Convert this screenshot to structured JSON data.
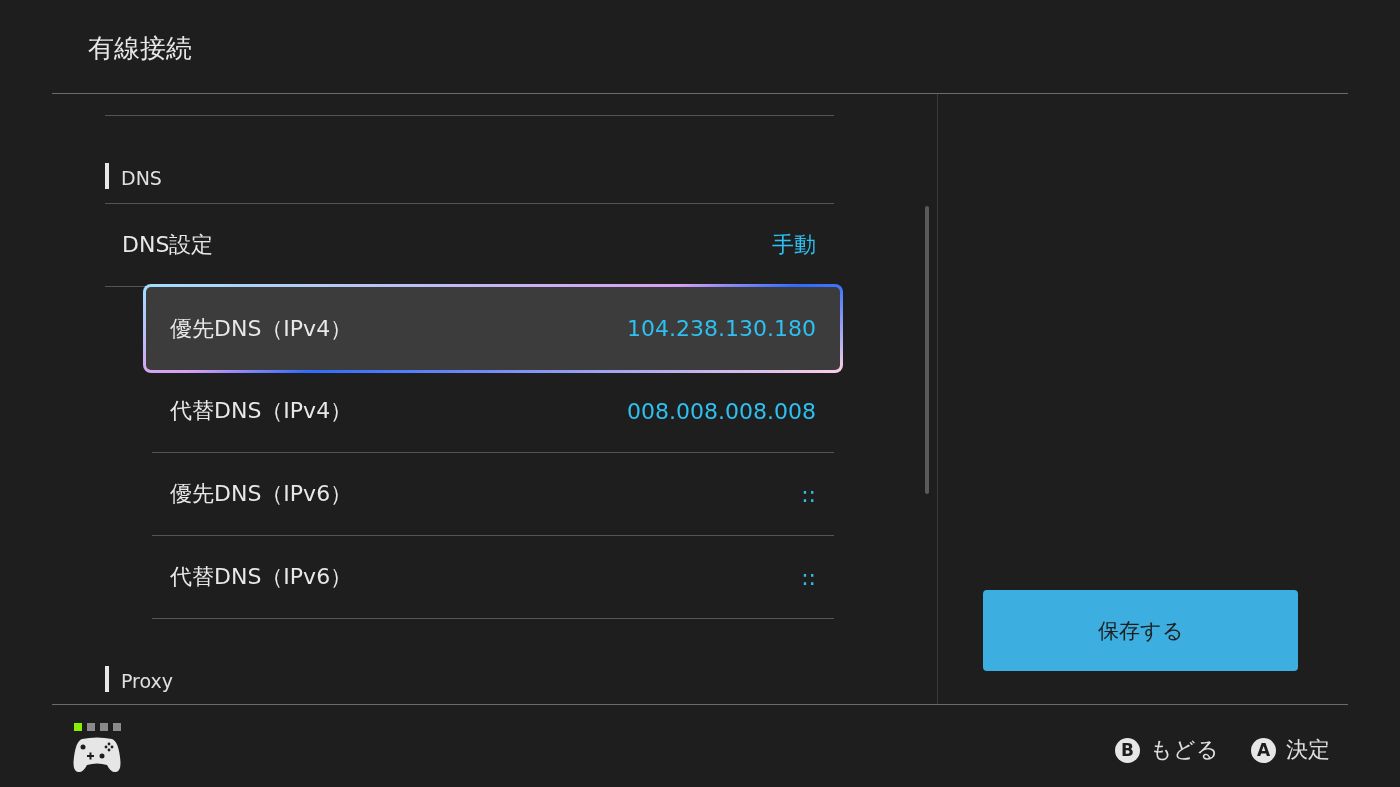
{
  "window": {
    "title": "有線接続"
  },
  "sections": [
    {
      "heading": "DNS",
      "settings": [
        {
          "label": "DNS設定",
          "value": "手動",
          "children": [
            {
              "label": "優先DNS（IPv4）",
              "value": "104.238.130.180",
              "selected": true
            },
            {
              "label": "代替DNS（IPv4）",
              "value": "008.008.008.008",
              "selected": false
            },
            {
              "label": "優先DNS（IPv6）",
              "value": "::",
              "selected": false
            },
            {
              "label": "代替DNS（IPv6）",
              "value": "::",
              "selected": false
            }
          ]
        }
      ]
    },
    {
      "heading": "Proxy"
    }
  ],
  "save_button": {
    "label": "保存する"
  },
  "player_lights": [
    {
      "on": true
    },
    {
      "on": false
    },
    {
      "on": false
    },
    {
      "on": false
    }
  ],
  "footer_buttons": [
    {
      "key": "B",
      "label": "もどる"
    },
    {
      "key": "A",
      "label": "決定"
    }
  ]
}
